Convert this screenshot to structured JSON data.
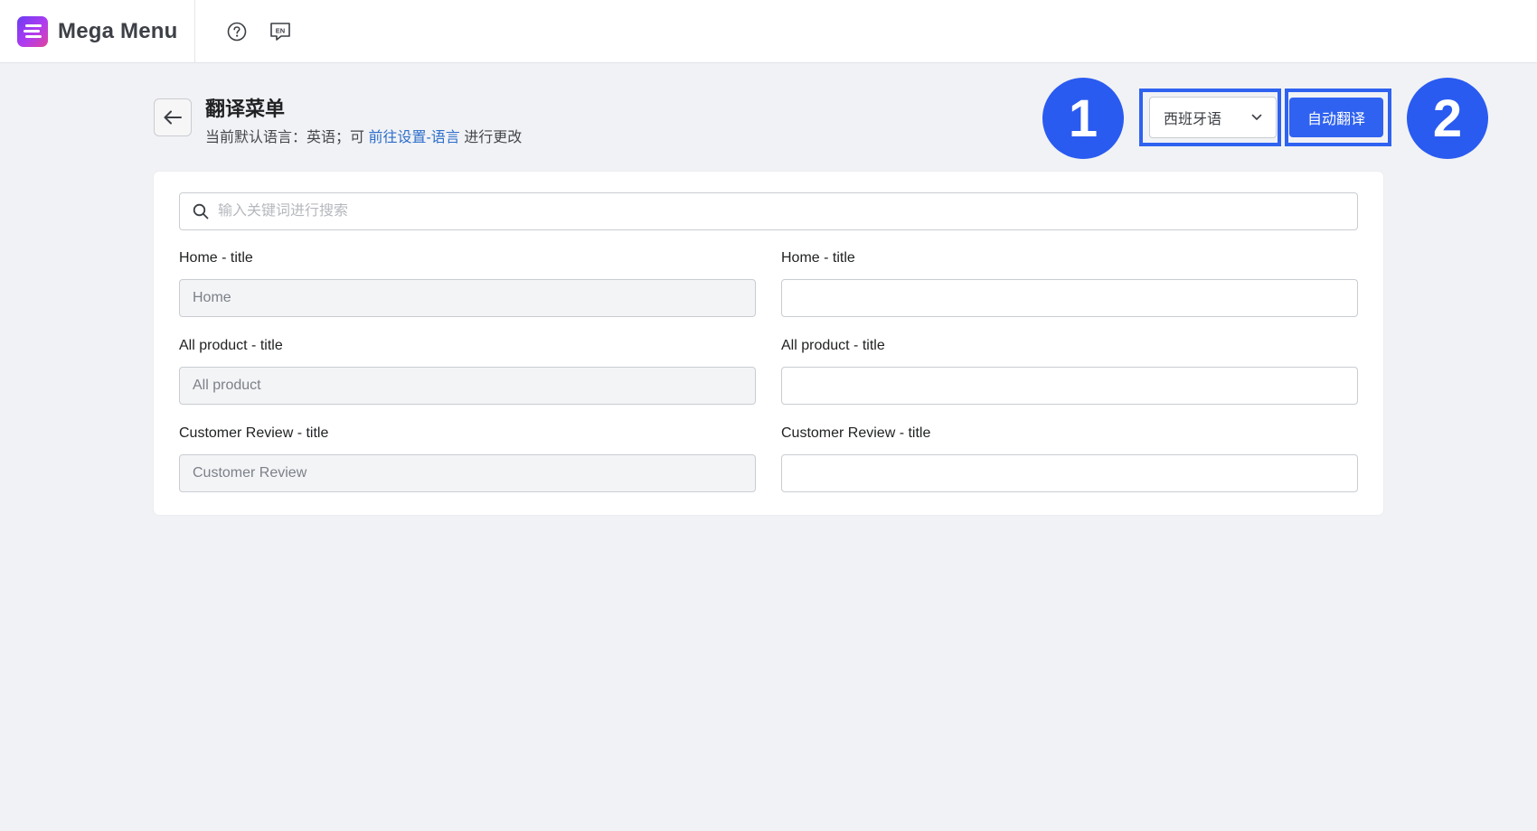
{
  "app": {
    "name": "Mega Menu",
    "lang_badge": "EN"
  },
  "page": {
    "title": "翻译菜单",
    "subtitle_prefix": "当前默认语言：英语；可 ",
    "subtitle_link": "前往设置-语言",
    "subtitle_suffix": " 进行更改"
  },
  "toolbar": {
    "language_select_value": "西班牙语",
    "auto_translate_label": "自动翻译"
  },
  "callouts": [
    "1",
    "2"
  ],
  "search": {
    "placeholder": "输入关键词进行搜索",
    "value": ""
  },
  "rows": [
    {
      "label": "Home - title",
      "source_value": "Home",
      "target_value": ""
    },
    {
      "label": "All product - title",
      "source_value": "All product",
      "target_value": ""
    },
    {
      "label": "Customer Review - title",
      "source_value": "Customer Review",
      "target_value": ""
    }
  ],
  "colors": {
    "accent": "#2f62f0",
    "link": "#2c6ecb",
    "background": "#f1f2f5"
  }
}
